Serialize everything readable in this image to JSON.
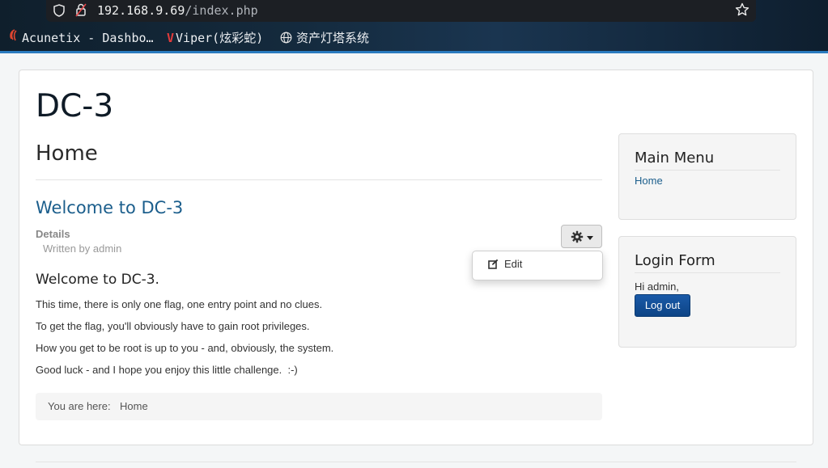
{
  "browser": {
    "url_host": "192.168.9.69",
    "url_path": "/index.php",
    "bookmarks": [
      {
        "label": "Acunetix - Dashbo…",
        "icon": "acunetix-icon"
      },
      {
        "label": "Viper(炫彩蛇)",
        "icon": "viper-icon"
      },
      {
        "label": "资产灯塔系统",
        "icon": "globe-icon"
      }
    ],
    "colors": {
      "chrome_bg": "#142a3d",
      "accent": "#2a7bbf"
    }
  },
  "site": {
    "title": "DC-3",
    "page_heading": "Home"
  },
  "article": {
    "title": "Welcome to DC-3",
    "details_label": "Details",
    "written_by": "Written by admin",
    "tools_menu": {
      "edit_label": "Edit"
    },
    "body_heading": "Welcome to DC-3.",
    "paragraphs": [
      "This time, there is only one flag, one entry point and no clues.",
      "To get the flag, you'll obviously have to gain root privileges.",
      "How you get to be root is up to you - and, obviously, the system.",
      "Good luck - and I hope you enjoy this little challenge.  :-)"
    ]
  },
  "breadcrumb": {
    "label": "You are here:",
    "items": [
      "Home"
    ]
  },
  "sidebar": {
    "main_menu": {
      "title": "Main Menu",
      "items": [
        "Home"
      ]
    },
    "login_form": {
      "title": "Login Form",
      "greeting": "Hi admin,",
      "logout_label": "Log out"
    }
  },
  "colors": {
    "link": "#1b5e8c",
    "button": "#1a5aa8"
  }
}
